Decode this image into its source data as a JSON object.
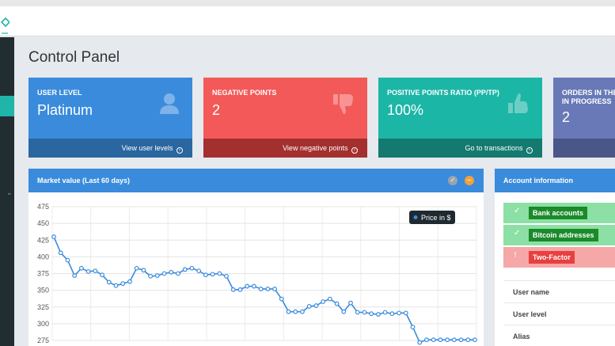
{
  "page": {
    "title": "Control Panel"
  },
  "stats": [
    {
      "heading": "User level",
      "value": "Platinum",
      "footer": "View user levels",
      "icon": "user-icon"
    },
    {
      "heading": "Negative points",
      "value": "2",
      "footer": "View negative points",
      "icon": "thumbs-down-icon"
    },
    {
      "heading": "Positive points ratio (pp/tp)",
      "value": "100%",
      "footer": "Go to transactions",
      "icon": "thumbs-up-icon"
    },
    {
      "heading": "Orders in the in progress",
      "value": "2",
      "footer": "",
      "icon": ""
    }
  ],
  "market": {
    "title": "Market value (Last 60 days)",
    "buttons": {
      "check": "✓",
      "minus": "−"
    }
  },
  "chart_data": {
    "type": "line",
    "title": "Market value (Last 60 days)",
    "xlabel": "",
    "ylabel": "",
    "ylim": [
      275,
      475
    ],
    "y_ticks": [
      475,
      450,
      425,
      400,
      375,
      350,
      325,
      300,
      275
    ],
    "grid": true,
    "legend_position": "top-right",
    "series": [
      {
        "name": "Price in $",
        "color": "#3a8bdc",
        "values": [
          430,
          406,
          395,
          372,
          383,
          378,
          379,
          373,
          362,
          357,
          360,
          363,
          383,
          380,
          371,
          372,
          375,
          377,
          375,
          381,
          383,
          379,
          373,
          374,
          375,
          371,
          351,
          351,
          356,
          356,
          352,
          352,
          352,
          337,
          318,
          318,
          318,
          326,
          327,
          333,
          337,
          330,
          318,
          331,
          317,
          317,
          315,
          314,
          317,
          315,
          316,
          316,
          295,
          272,
          276,
          276,
          276,
          276,
          276,
          276,
          276,
          276
        ]
      }
    ]
  },
  "account": {
    "title": "Account information",
    "statuses": [
      {
        "mark": "✓",
        "label": "Bank accounts",
        "state": "ok"
      },
      {
        "mark": "✓",
        "label": "Bitcoin addresses",
        "state": "ok"
      },
      {
        "mark": "!",
        "label": "Two-Factor",
        "state": "bad"
      }
    ],
    "fields": [
      {
        "label": "User name"
      },
      {
        "label": "User level"
      },
      {
        "label": "Alias"
      }
    ]
  },
  "colors": {
    "blue": "#3a8bdc",
    "red": "#f35958",
    "teal": "#1cb6a6",
    "purple": "#6979b7",
    "sidebar": "#222d32",
    "sidebar_active": "#1fb5a8"
  }
}
